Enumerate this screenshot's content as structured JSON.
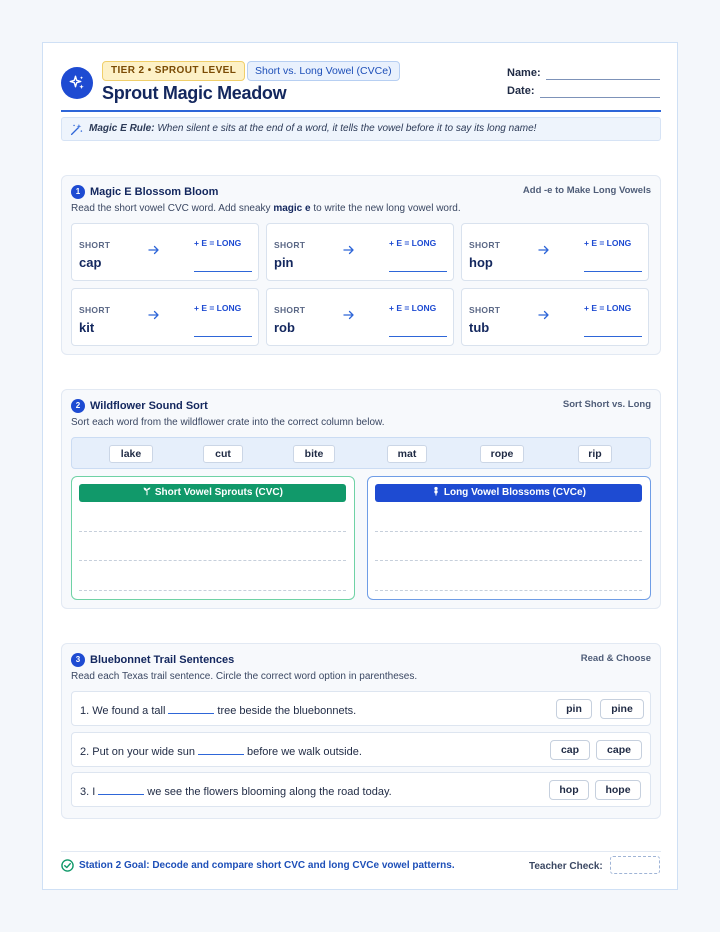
{
  "header": {
    "tier_badge": "TIER 2 • SPROUT LEVEL",
    "topic_badge": "Short vs. Long Vowel (CVCe)",
    "title": "Sprout Magic Meadow",
    "name_label": "Name:",
    "date_label": "Date:",
    "logo_icon": "sparkle-icon"
  },
  "rule": {
    "label": "Magic E Rule:",
    "text": "When silent e sits at the end of a word, it tells the vowel before it to say its long name!"
  },
  "section1": {
    "number": "1",
    "title": "Magic E Blossom Bloom",
    "right_label": "Add -e to Make Long Vowels",
    "instruction_pre": "Read the short vowel CVC word. Add sneaky ",
    "instruction_bold": "magic e",
    "instruction_post": " to write the new long vowel word.",
    "short_label": "SHORT",
    "long_label": "+ E = LONG",
    "words": [
      "cap",
      "pin",
      "hop",
      "kit",
      "rob",
      "tub"
    ]
  },
  "section2": {
    "number": "2",
    "title": "Wildflower Sound Sort",
    "right_label": "Sort Short vs. Long",
    "instruction": "Sort each word from the wildflower crate into the correct column below.",
    "crate_words": [
      "lake",
      "cut",
      "bite",
      "mat",
      "rope",
      "rip"
    ],
    "short_column": "Short Vowel Sprouts (CVC)",
    "long_column": "Long Vowel Blossoms (CVCe)"
  },
  "section3": {
    "number": "3",
    "title": "Bluebonnet Trail Sentences",
    "right_label": "Read & Choose",
    "instruction": "Read each Texas trail sentence. Circle the correct word option in parentheses.",
    "sentences": [
      {
        "before": "1. We found a tall",
        "after": "tree beside the bluebonnets.",
        "options": [
          "pin",
          "pine"
        ]
      },
      {
        "before": "2. Put on your wide sun",
        "after": "before we walk outside.",
        "options": [
          "cap",
          "cape"
        ]
      },
      {
        "before": "3. I",
        "after": "we see the flowers blooming along the road today.",
        "options": [
          "hop",
          "hope"
        ]
      }
    ]
  },
  "footer": {
    "goal": "Station 2 Goal: Decode and compare short CVC and long CVCe vowel patterns.",
    "teacher_check": "Teacher Check:"
  },
  "colors": {
    "primary": "#1e4bd2",
    "green": "#11996a",
    "badge_yellow": "#fdf1c7"
  }
}
